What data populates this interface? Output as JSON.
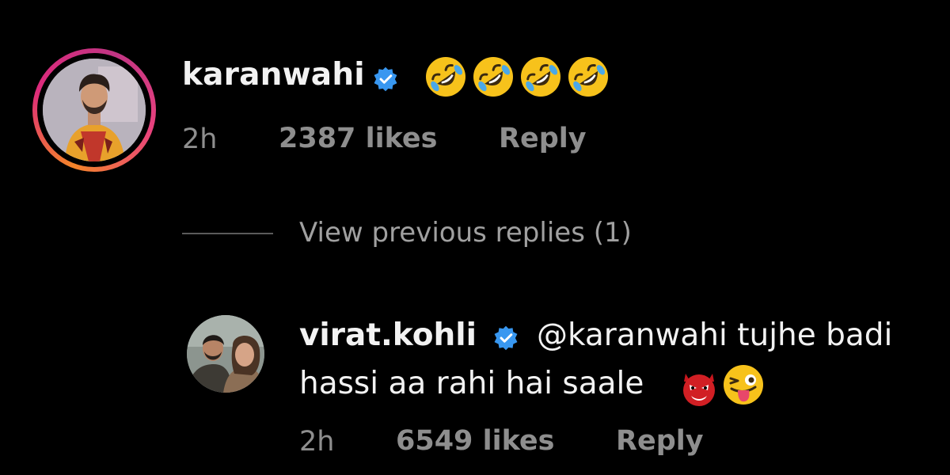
{
  "top_comment": {
    "username": "karanwahi",
    "verified": true,
    "emojis": [
      "rolling-on-floor-laughing",
      "rolling-on-floor-laughing",
      "rolling-on-floor-laughing",
      "rolling-on-floor-laughing"
    ],
    "time": "2h",
    "likes": "2387 likes",
    "reply_label": "Reply"
  },
  "thread": {
    "view_previous_label": "View previous replies (1)"
  },
  "reply": {
    "username": "virat.kohli",
    "verified": true,
    "text_line_1": "@karanwahi tujhe badi",
    "text_line_2": "hassi aa rahi hai saale",
    "emojis": [
      "devil-face",
      "winking-face-with-tongue"
    ],
    "time": "2h",
    "likes": "6549 likes",
    "reply_label": "Reply"
  },
  "colors": {
    "background": "#000000",
    "primary_text": "#f2f2f2",
    "secondary_text": "#8e8e8e",
    "verified_blue": "#3897f0",
    "story_ring": [
      "#f58529",
      "#dd2a7b",
      "#c13584"
    ]
  }
}
